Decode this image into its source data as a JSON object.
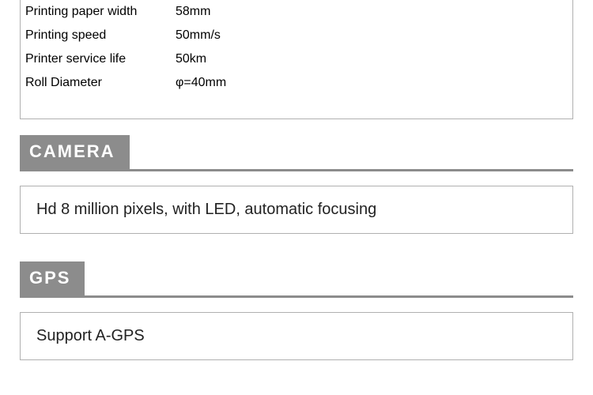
{
  "printing_specs": [
    {
      "label": "Printing paper width",
      "value": "58mm"
    },
    {
      "label": "Printing speed",
      "value": "50mm/s"
    },
    {
      "label": "Printer service life",
      "value": "50km"
    },
    {
      "label": "Roll Diameter",
      "value": "φ=40mm"
    }
  ],
  "sections": {
    "camera": {
      "title": "CAMERA",
      "content": "Hd 8 million pixels, with LED, automatic focusing"
    },
    "gps": {
      "title": "GPS",
      "content": "Support A-GPS"
    }
  }
}
